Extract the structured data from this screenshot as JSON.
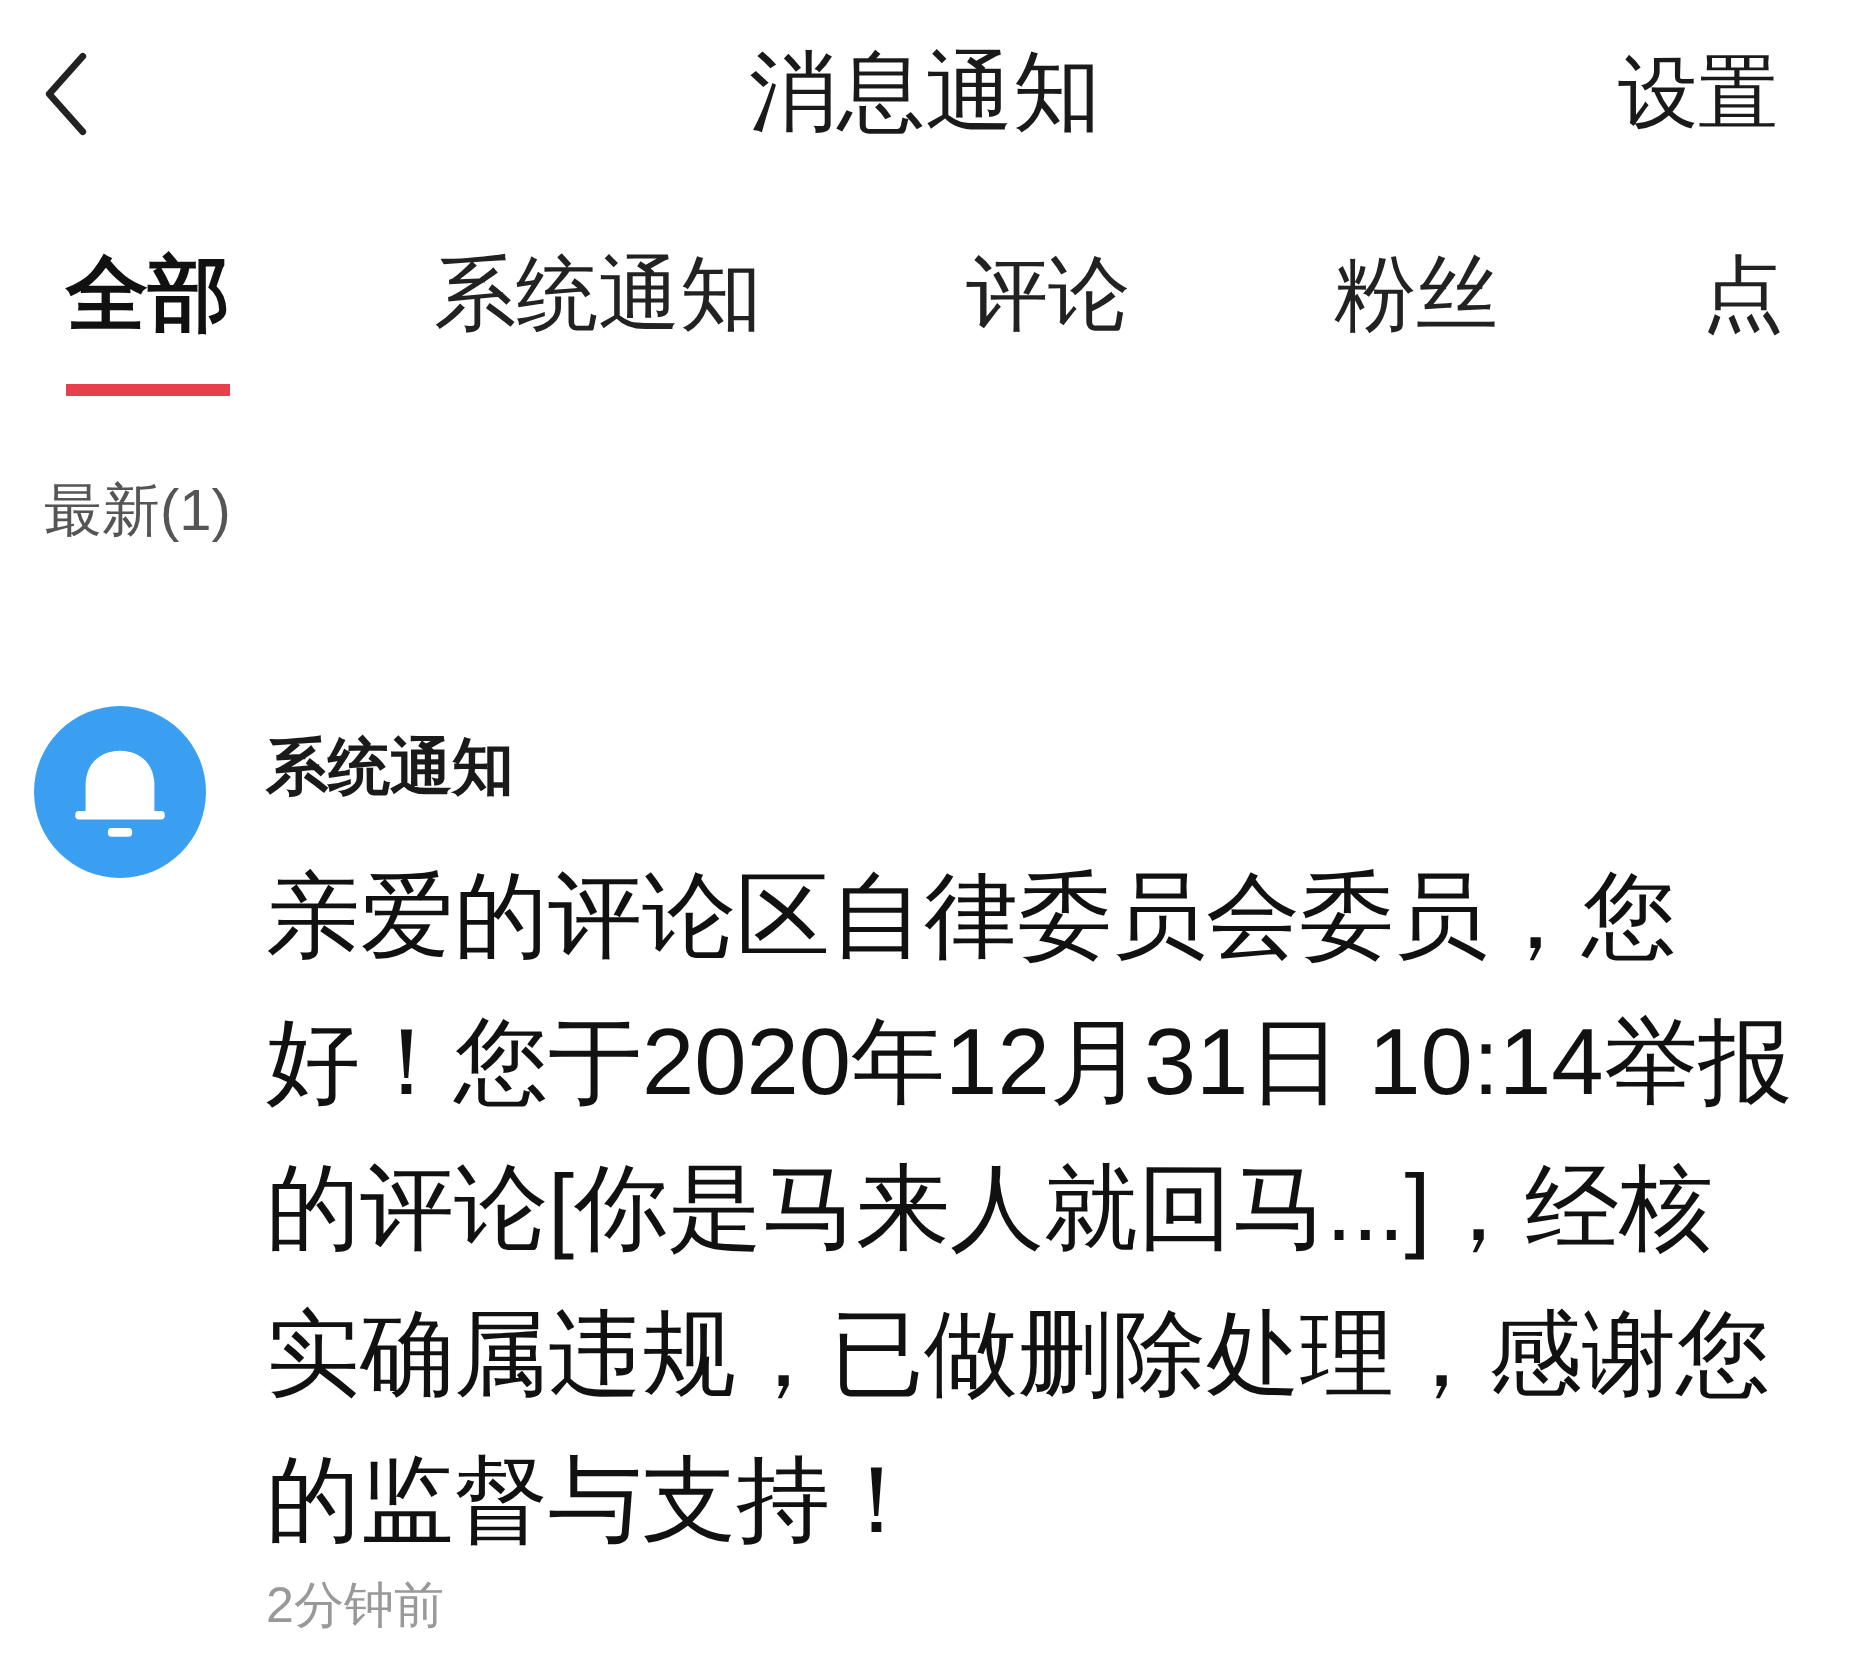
{
  "header": {
    "title": "消息通知",
    "action": "设置"
  },
  "tabs": [
    {
      "label": "全部",
      "selected": true
    },
    {
      "label": "系统通知",
      "selected": false
    },
    {
      "label": "评论",
      "selected": false
    },
    {
      "label": "粉丝",
      "selected": false
    },
    {
      "label": "点",
      "selected": false
    }
  ],
  "section": {
    "title": "最新(1)"
  },
  "notifications": [
    {
      "kind": "system",
      "sender": "系统通知",
      "message": "亲爱的评论区自律委员会委员，您好！您于2020年12月31日 10:14举报的评论[你是马来人就回马...]，经核实确属违规，已做删除处理，感谢您的监督与支持！",
      "time": "2分钟前"
    }
  ]
}
